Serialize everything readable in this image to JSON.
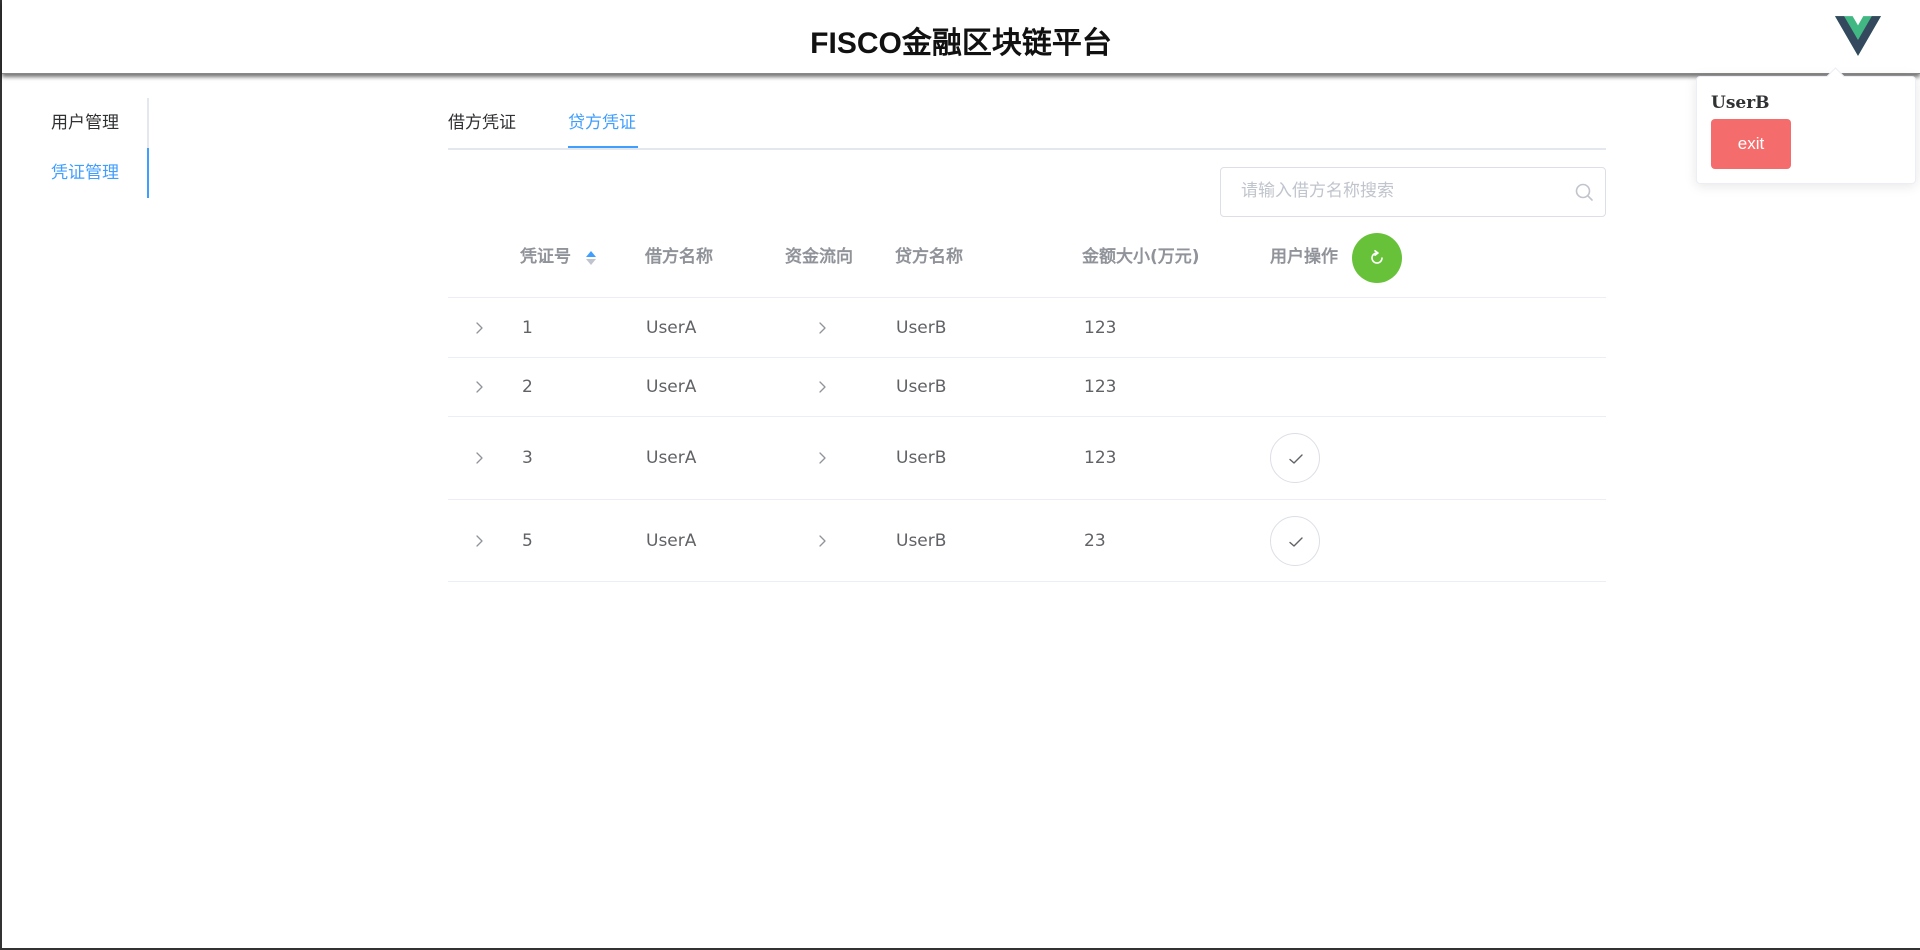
{
  "header": {
    "title": "FISCO金融区块链平台"
  },
  "user_popover": {
    "username": "UserB",
    "exit_label": "exit"
  },
  "sidebar": {
    "items": [
      {
        "label": "用户管理"
      },
      {
        "label": "凭证管理"
      }
    ]
  },
  "tabs": [
    {
      "label": "借方凭证"
    },
    {
      "label": "贷方凭证"
    }
  ],
  "search": {
    "placeholder": "请输入借方名称搜索",
    "value": ""
  },
  "table": {
    "columns": [
      "凭证号",
      "借方名称",
      "资金流向",
      "贷方名称",
      "金额大小(万元)",
      "用户操作"
    ],
    "rows": [
      {
        "id": "1",
        "debtor": "UserA",
        "creditor": "UserB",
        "amount": "123",
        "has_action": false
      },
      {
        "id": "2",
        "debtor": "UserA",
        "creditor": "UserB",
        "amount": "123",
        "has_action": false
      },
      {
        "id": "3",
        "debtor": "UserA",
        "creditor": "UserB",
        "amount": "123",
        "has_action": true
      },
      {
        "id": "5",
        "debtor": "UserA",
        "creditor": "UserB",
        "amount": "23",
        "has_action": true
      }
    ]
  },
  "colors": {
    "primary": "#409eff",
    "success": "#67c23a",
    "danger": "#f56c6c",
    "logo_green": "#41b883",
    "logo_dark": "#35495e"
  },
  "icons": {
    "logo": "vue-logo-icon",
    "search": "search-icon",
    "sort": "sort-caret-icon",
    "refresh": "refresh-icon",
    "expand": "chevron-right-icon",
    "flow": "arrow-right-icon",
    "confirm": "check-icon"
  }
}
